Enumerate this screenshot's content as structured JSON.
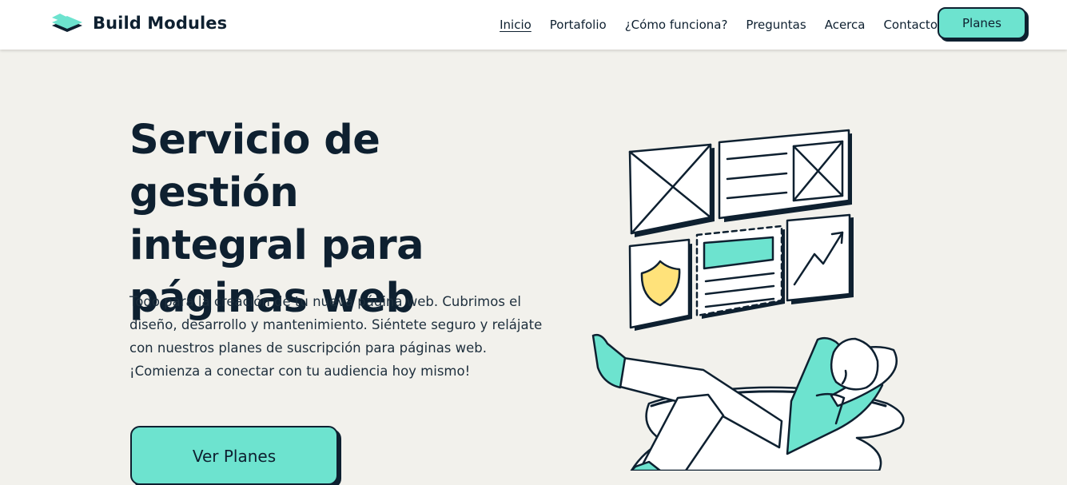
{
  "header": {
    "brand_name": "Build Modules",
    "nav": [
      {
        "label": "Inicio",
        "active": true
      },
      {
        "label": "Portafolio"
      },
      {
        "label": "¿Cómo funciona?"
      },
      {
        "label": "Preguntas"
      },
      {
        "label": "Acerca"
      },
      {
        "label": "Contacto"
      }
    ],
    "cta_label": "Planes"
  },
  "hero": {
    "title_lines": [
      "Servicio de gestión",
      "integral para",
      "páginas web"
    ],
    "description_lines": [
      "Todo para la creación de tu nueva página web. Cubrimos el",
      "diseño, desarrollo y mantenimiento. Siéntete seguro y relájate",
      "con nuestros planes de suscripción para páginas web.",
      "¡Comienza a conectar con tu audiencia hoy mismo!"
    ],
    "cta_label": "Ver Planes"
  },
  "colors": {
    "accent": "#6de3cf",
    "dark": "#0e2030",
    "background": "#f2f1ec",
    "shield": "#ffe27a"
  }
}
